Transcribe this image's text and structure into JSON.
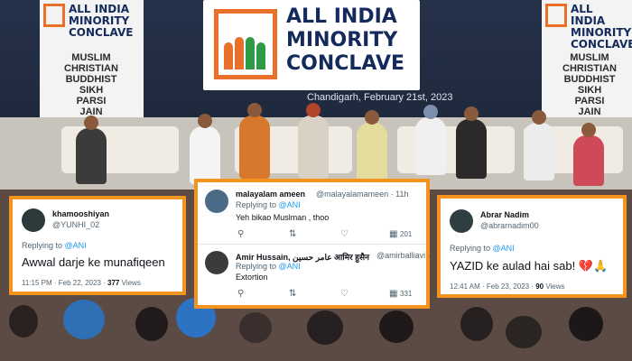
{
  "background": {
    "banner_title": "ALL INDIA MINORITY CONCLAVE",
    "venue_date": "Chandigarh, February 21st, 2023",
    "left_banner_title": "ALL INDIA MINORITY CONCLAVE",
    "left_banner_words": [
      "MUSLIM",
      "CHRISTIAN",
      "BUDDHIST",
      "SIKH",
      "PARSI",
      "JAIN"
    ],
    "right_banner_title": "ALL INDIA MINORITY CONCLAVE",
    "right_banner_words": [
      "MUSLIM",
      "CHRISTIAN",
      "BUDDHIST",
      "SIKH",
      "PARSI",
      "JAIN"
    ]
  },
  "tweets": {
    "left": {
      "name": "khamooshiyan",
      "handle": "@YUNHI_02",
      "replying": "Replying to",
      "reply_to": "@ANI",
      "text": "Awwal darje ke munafiqeen",
      "time": "11:15 PM · Feb 22, 2023 ·",
      "views": "377",
      "views_label": "Views"
    },
    "center_top": {
      "name": "malayalam ameen",
      "handle": "@malayalamameen · 11h",
      "replying": "Replying to",
      "reply_to": "@ANI",
      "text": "Yeh bikao Muslman , thoo",
      "views": "201"
    },
    "center_bottom": {
      "name": "Amir Hussain, عامر حسین आमिर हुसैन",
      "handle": "@amirballiavi ·",
      "replying": "Replying to",
      "reply_to": "@ANI",
      "text": "Extortion",
      "views": "331"
    },
    "right": {
      "name": "Abrar Nadim",
      "handle": "@abrarnadim00",
      "replying": "Replying to",
      "reply_to": "@ANI",
      "text": "YAZID ke aulad hai sab!",
      "emoji": "💔🙏",
      "time": "12:41 AM · Feb 23, 2023 ·",
      "views": "90",
      "views_label": "Views"
    }
  },
  "icons": {
    "reply": "reply-icon",
    "retweet": "retweet-icon",
    "like": "like-icon",
    "views": "views-icon",
    "share": "share-icon"
  },
  "colors": {
    "card_border": "#f5931f",
    "link": "#1d9bf0",
    "banner_text": "#152a5c",
    "saffron": "#e8702a",
    "green": "#2e9b47"
  }
}
